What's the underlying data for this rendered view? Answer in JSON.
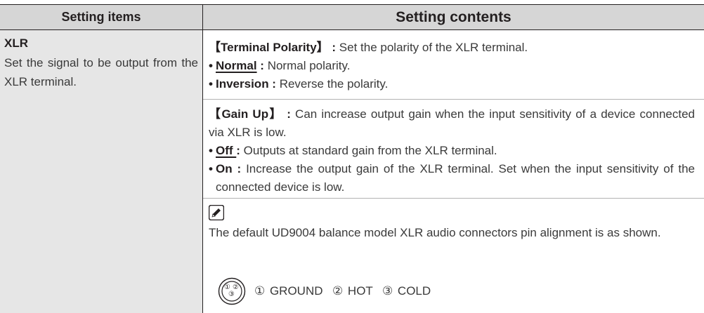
{
  "header": {
    "col_items": "Setting items",
    "col_contents": "Setting contents"
  },
  "item": {
    "title": "XLR",
    "description": "Set the signal to be output from the XLR terminal."
  },
  "terminal_polarity": {
    "heading": "【Terminal Polarity】 :",
    "description": " Set the polarity of the XLR terminal.",
    "options": [
      {
        "label": "Normal",
        "separator": " :",
        "text": " Normal polarity.",
        "default": true
      },
      {
        "label": "Inversion :",
        "text": " Reverse the polarity.",
        "default": false
      }
    ]
  },
  "gain_up": {
    "heading": "【Gain Up】 :",
    "description": " Can increase output gain when the input sensitivity of a device connected via XLR is low.",
    "options": [
      {
        "label": "Off ",
        "separator": ":",
        "text": " Outputs at standard gain from the XLR terminal.",
        "default": true
      },
      {
        "label": "On :",
        "text": " Increase the output gain of the XLR terminal. Set when the input sensitivity of the connected device is low.",
        "default": false
      }
    ]
  },
  "note": {
    "icon": "pencil-icon",
    "text": "The default UD9004 balance model XLR audio connectors pin alignment is as shown.",
    "pins": "① GROUND  ② HOT  ③ COLD",
    "connector_labels": [
      "①",
      "②",
      "③"
    ]
  },
  "bullet_glyph": "•"
}
